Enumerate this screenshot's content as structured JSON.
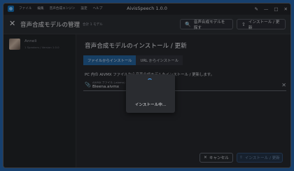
{
  "titlebar": {
    "title": "AivisSpeech 1.0.0",
    "menu": [
      "ファイル",
      "編集",
      "音声合成エンジン",
      "設定",
      "ヘルプ"
    ],
    "controls": {
      "pin": "✎",
      "minimize": "—",
      "maximize": "□",
      "close": "✕"
    }
  },
  "header": {
    "close_glyph": "✕",
    "title": "音声合成モデルの管理",
    "count": "合計 1 モデル",
    "search_label": "音声合成モデルを探す",
    "install_label": "インストール / 更新",
    "search_icon": "🔍",
    "install_icon": "⇧"
  },
  "sidebar": {
    "items": [
      {
        "name": "Anneli",
        "meta": "1 Speakers / Version 1.0.0"
      }
    ]
  },
  "main": {
    "title": "音声合成モデルのインストール / 更新",
    "tabs": [
      "ファイルからインストール",
      "URL からインストール"
    ],
    "description": "PC 内の AIVMX ファイルから音声合成モデルをインストール / 更新します。",
    "file": {
      "label": "AIVMX ファイル (.aivmx)",
      "value": "Bleena.aivmx",
      "clear_glyph": "✕",
      "icon": "📎"
    },
    "cancel_label": "キャンセル",
    "cancel_glyph": "✕",
    "install_label": "インストール / 更新",
    "install_glyph": "⇧"
  },
  "dialog": {
    "text": "インストール中..."
  },
  "colors": {
    "accent": "#1d5e98",
    "spinner": "#4aa7ff",
    "desktop": "#17406e"
  }
}
